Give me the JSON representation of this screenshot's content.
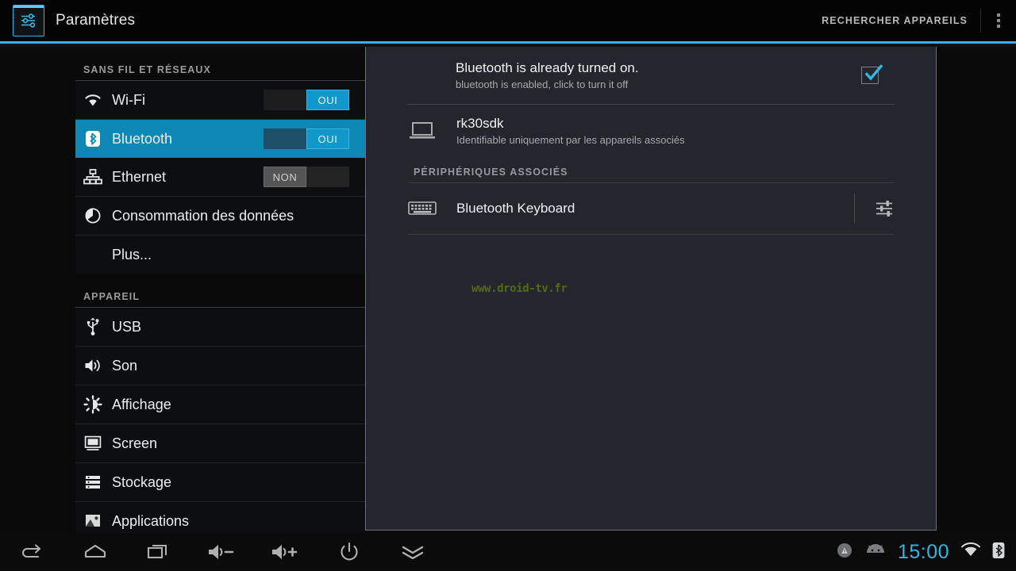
{
  "titlebar": {
    "app_icon": "settings-sliders-icon",
    "title": "Paramètres",
    "search_devices_label": "RECHERCHER APPAREILS",
    "overflow_icon": "overflow-menu-icon"
  },
  "sidebar": {
    "sections": [
      {
        "header": "SANS FIL ET RÉSEAUX",
        "items": [
          {
            "label": "Wi-Fi",
            "icon": "wifi-icon",
            "toggle": "OUI",
            "toggle_state": "on",
            "selected": false
          },
          {
            "label": "Bluetooth",
            "icon": "bluetooth-icon",
            "toggle": "OUI",
            "toggle_state": "on",
            "selected": true
          },
          {
            "label": "Ethernet",
            "icon": "ethernet-icon",
            "toggle": "NON",
            "toggle_state": "off",
            "selected": false
          },
          {
            "label": "Consommation des données",
            "icon": "data-usage-icon",
            "toggle": null,
            "selected": false
          },
          {
            "label": "Plus...",
            "icon": null,
            "toggle": null,
            "selected": false
          }
        ]
      },
      {
        "header": "APPAREIL",
        "items": [
          {
            "label": "USB",
            "icon": "usb-icon",
            "toggle": null,
            "selected": false
          },
          {
            "label": "Son",
            "icon": "sound-icon",
            "toggle": null,
            "selected": false
          },
          {
            "label": "Affichage",
            "icon": "display-brightness-icon",
            "toggle": null,
            "selected": false
          },
          {
            "label": "Screen",
            "icon": "monitor-icon",
            "toggle": null,
            "selected": false
          },
          {
            "label": "Stockage",
            "icon": "storage-icon",
            "toggle": null,
            "selected": false
          },
          {
            "label": "Applications",
            "icon": "applications-icon",
            "toggle": null,
            "selected": false
          }
        ]
      }
    ]
  },
  "panel": {
    "status": {
      "title": "Bluetooth is already turned on.",
      "subtitle": "bluetooth is enabled, click to turn it off",
      "checkbox_icon": "checkbox-checked-icon",
      "checkbox_checked": true
    },
    "local_device": {
      "name": "rk30sdk",
      "subtitle": "Identifiable uniquement par les appareils associés",
      "icon": "laptop-icon"
    },
    "paired_section_header": "PÉRIPHÉRIQUES ASSOCIÉS",
    "paired_devices": [
      {
        "name": "Bluetooth Keyboard",
        "icon": "keyboard-icon",
        "settings_icon": "device-settings-sliders-icon"
      }
    ],
    "watermark": "www.droid-tv.fr"
  },
  "navbar": {
    "buttons": [
      {
        "name": "back-icon"
      },
      {
        "name": "home-icon"
      },
      {
        "name": "recent-apps-icon"
      },
      {
        "name": "volume-down-icon"
      },
      {
        "name": "volume-up-icon"
      },
      {
        "name": "power-icon"
      },
      {
        "name": "hide-keyboard-icon"
      }
    ],
    "status": {
      "alert_icon": "alert-circle-icon",
      "android_icon": "android-head-icon",
      "clock": "15:00",
      "wifi_icon": "wifi-signal-icon",
      "bluetooth_icon": "bluetooth-status-icon"
    }
  },
  "colors": {
    "accent": "#33b5e5",
    "selected_row": "#0d88b4",
    "toggle_on": "#1197c9",
    "clock": "#33b5e5",
    "watermark": "#4f6b14"
  }
}
